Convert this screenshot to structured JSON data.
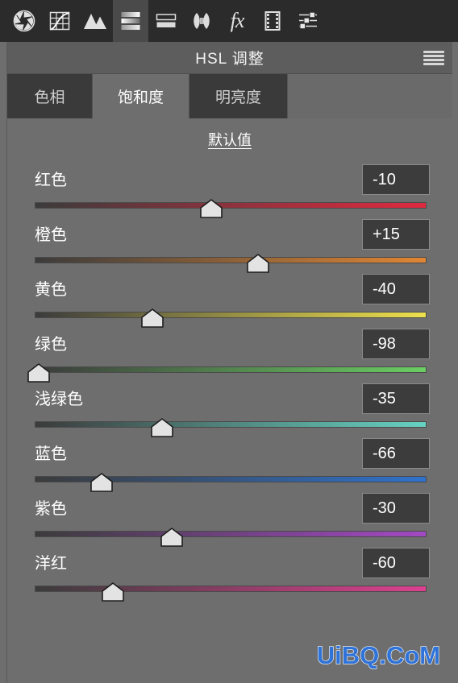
{
  "toolbar": {
    "items": [
      {
        "icon": "aperture-icon",
        "label": "基本",
        "active": false
      },
      {
        "icon": "tone-curve-icon",
        "label": "色调曲线",
        "active": false
      },
      {
        "icon": "mountains-icon",
        "label": "细节",
        "active": false
      },
      {
        "icon": "hsl-bars-icon",
        "label": "HSL 调整",
        "active": true
      },
      {
        "icon": "split-tone-icon",
        "label": "分离色调",
        "active": false
      },
      {
        "icon": "lens-correction-icon",
        "label": "镜头校正",
        "active": false
      },
      {
        "icon": "fx-icon",
        "label": "效果",
        "active": false
      },
      {
        "icon": "filmstrip-icon",
        "label": "相机校准",
        "active": false
      },
      {
        "icon": "presets-sliders-icon",
        "label": "预设",
        "active": false
      }
    ]
  },
  "panel": {
    "title": "HSL 调整",
    "menu_icon": "hamburger-menu-icon",
    "tabs": [
      {
        "label": "色相",
        "selected": false
      },
      {
        "label": "饱和度",
        "selected": true
      },
      {
        "label": "明亮度",
        "selected": false
      }
    ],
    "defaults_label": "默认值"
  },
  "sliders": [
    {
      "name": "red",
      "label": "红色",
      "value": "-10",
      "percent": 45.0,
      "gradient_from": "#3b3b3b",
      "gradient_to": "#e02a40"
    },
    {
      "name": "orange",
      "label": "橙色",
      "value": "+15",
      "percent": 57.0,
      "gradient_from": "#3b3b3b",
      "gradient_to": "#e08634"
    },
    {
      "name": "yellow",
      "label": "黄色",
      "value": "-40",
      "percent": 30.0,
      "gradient_from": "#3b3b3b",
      "gradient_to": "#eee04e"
    },
    {
      "name": "green",
      "label": "绿色",
      "value": "-98",
      "percent": 1.0,
      "gradient_from": "#3b3b3b",
      "gradient_to": "#6ace62"
    },
    {
      "name": "aqua",
      "label": "浅绿色",
      "value": "-35",
      "percent": 32.5,
      "gradient_from": "#3b3b3b",
      "gradient_to": "#66d2c2"
    },
    {
      "name": "blue",
      "label": "蓝色",
      "value": "-66",
      "percent": 17.0,
      "gradient_from": "#3b3b3b",
      "gradient_to": "#2f72cc"
    },
    {
      "name": "purple",
      "label": "紫色",
      "value": "-30",
      "percent": 35.0,
      "gradient_from": "#3b3b3b",
      "gradient_to": "#a349c4"
    },
    {
      "name": "magenta",
      "label": "洋红",
      "value": "-60",
      "percent": 20.0,
      "gradient_from": "#3b3b3b",
      "gradient_to": "#dd4090"
    }
  ],
  "watermark": {
    "text": "UiBQ.CoM",
    "color": "#2f73d8"
  }
}
